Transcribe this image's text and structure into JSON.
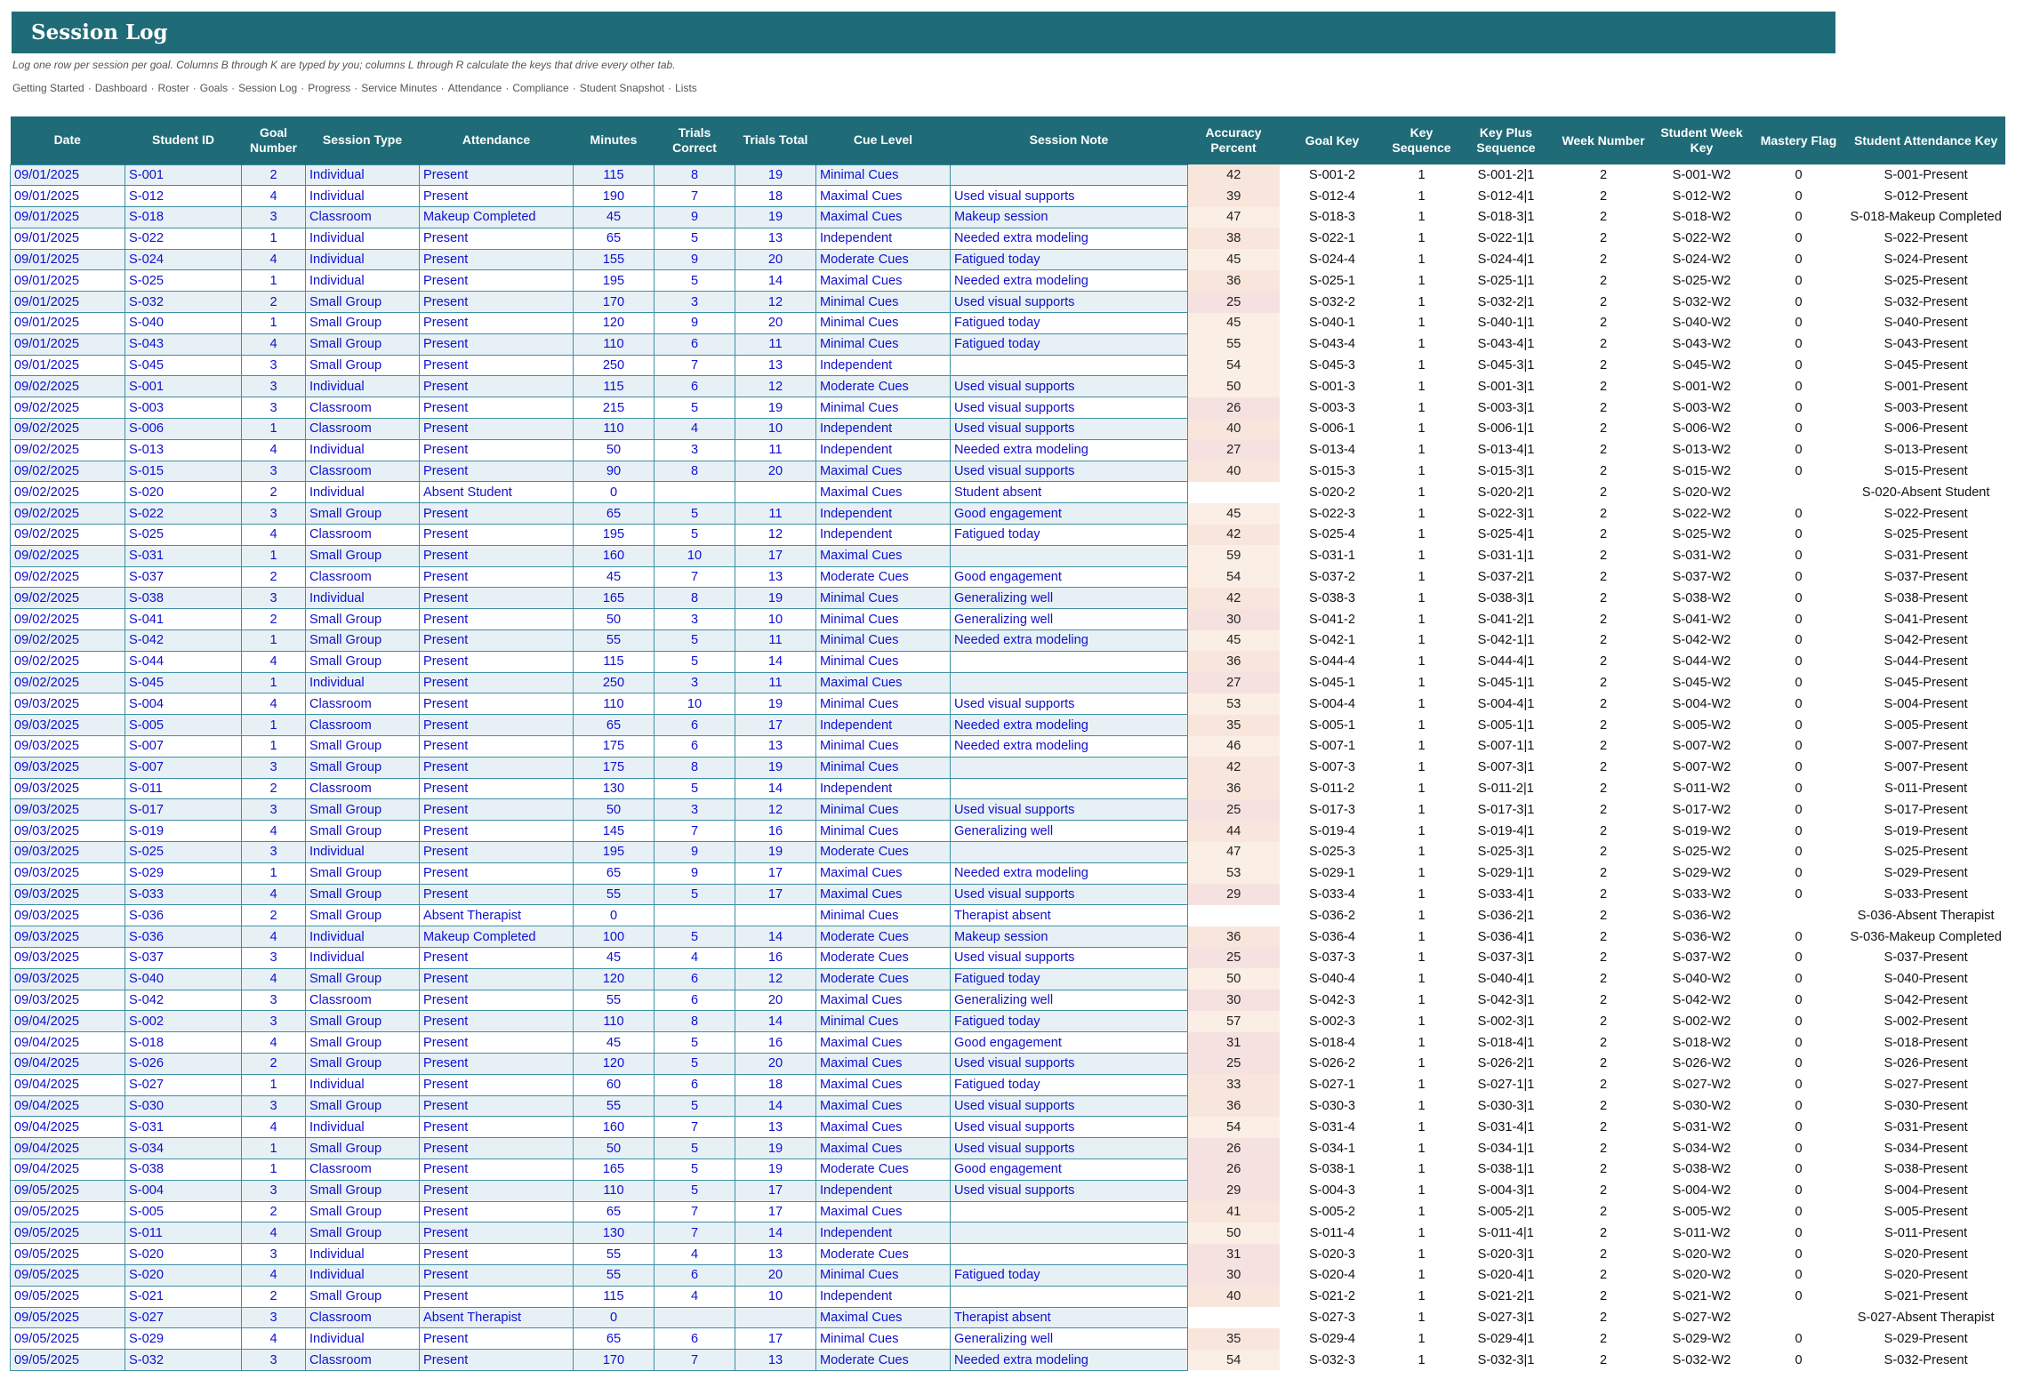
{
  "title": "Session Log",
  "subtitle": "Log one row per session per goal. Columns B through K are typed by you; columns L through R calculate the keys that drive every other tab.",
  "nav": [
    "Getting Started",
    "Dashboard",
    "Roster",
    "Goals",
    "Session Log",
    "Progress",
    "Service Minutes",
    "Attendance",
    "Compliance",
    "Student Snapshot",
    "Lists"
  ],
  "nav_separator": "·",
  "headers": [
    "Date",
    "Student ID",
    "Goal Number",
    "Session Type",
    "Attendance",
    "Minutes",
    "Trials Correct",
    "Trials Total",
    "Cue Level",
    "Session Note",
    "Accuracy Percent",
    "Goal Key",
    "Key Sequence",
    "Key Plus Sequence",
    "Week Number",
    "Student Week Key",
    "Mastery Flag",
    "Student Attendance Key"
  ],
  "rows": [
    [
      "09/01/2025",
      "S-001",
      "2",
      "Individual",
      "Present",
      "115",
      "8",
      "19",
      "Minimal Cues",
      "",
      "42",
      "S-001-2",
      "1",
      "S-001-2|1",
      "2",
      "S-001-W2",
      "0",
      "S-001-Present"
    ],
    [
      "09/01/2025",
      "S-012",
      "4",
      "Individual",
      "Present",
      "190",
      "7",
      "18",
      "Maximal Cues",
      "Used visual supports",
      "39",
      "S-012-4",
      "1",
      "S-012-4|1",
      "2",
      "S-012-W2",
      "0",
      "S-012-Present"
    ],
    [
      "09/01/2025",
      "S-018",
      "3",
      "Classroom",
      "Makeup Completed",
      "45",
      "9",
      "19",
      "Maximal Cues",
      "Makeup session",
      "47",
      "S-018-3",
      "1",
      "S-018-3|1",
      "2",
      "S-018-W2",
      "0",
      "S-018-Makeup Completed"
    ],
    [
      "09/01/2025",
      "S-022",
      "1",
      "Individual",
      "Present",
      "65",
      "5",
      "13",
      "Independent",
      "Needed extra modeling",
      "38",
      "S-022-1",
      "1",
      "S-022-1|1",
      "2",
      "S-022-W2",
      "0",
      "S-022-Present"
    ],
    [
      "09/01/2025",
      "S-024",
      "4",
      "Individual",
      "Present",
      "155",
      "9",
      "20",
      "Moderate Cues",
      "Fatigued today",
      "45",
      "S-024-4",
      "1",
      "S-024-4|1",
      "2",
      "S-024-W2",
      "0",
      "S-024-Present"
    ],
    [
      "09/01/2025",
      "S-025",
      "1",
      "Individual",
      "Present",
      "195",
      "5",
      "14",
      "Maximal Cues",
      "Needed extra modeling",
      "36",
      "S-025-1",
      "1",
      "S-025-1|1",
      "2",
      "S-025-W2",
      "0",
      "S-025-Present"
    ],
    [
      "09/01/2025",
      "S-032",
      "2",
      "Small Group",
      "Present",
      "170",
      "3",
      "12",
      "Minimal Cues",
      "Used visual supports",
      "25",
      "S-032-2",
      "1",
      "S-032-2|1",
      "2",
      "S-032-W2",
      "0",
      "S-032-Present"
    ],
    [
      "09/01/2025",
      "S-040",
      "1",
      "Small Group",
      "Present",
      "120",
      "9",
      "20",
      "Minimal Cues",
      "Fatigued today",
      "45",
      "S-040-1",
      "1",
      "S-040-1|1",
      "2",
      "S-040-W2",
      "0",
      "S-040-Present"
    ],
    [
      "09/01/2025",
      "S-043",
      "4",
      "Small Group",
      "Present",
      "110",
      "6",
      "11",
      "Minimal Cues",
      "Fatigued today",
      "55",
      "S-043-4",
      "1",
      "S-043-4|1",
      "2",
      "S-043-W2",
      "0",
      "S-043-Present"
    ],
    [
      "09/01/2025",
      "S-045",
      "3",
      "Small Group",
      "Present",
      "250",
      "7",
      "13",
      "Independent",
      "",
      "54",
      "S-045-3",
      "1",
      "S-045-3|1",
      "2",
      "S-045-W2",
      "0",
      "S-045-Present"
    ],
    [
      "09/02/2025",
      "S-001",
      "3",
      "Individual",
      "Present",
      "115",
      "6",
      "12",
      "Moderate Cues",
      "Used visual supports",
      "50",
      "S-001-3",
      "1",
      "S-001-3|1",
      "2",
      "S-001-W2",
      "0",
      "S-001-Present"
    ],
    [
      "09/02/2025",
      "S-003",
      "3",
      "Classroom",
      "Present",
      "215",
      "5",
      "19",
      "Minimal Cues",
      "Used visual supports",
      "26",
      "S-003-3",
      "1",
      "S-003-3|1",
      "2",
      "S-003-W2",
      "0",
      "S-003-Present"
    ],
    [
      "09/02/2025",
      "S-006",
      "1",
      "Classroom",
      "Present",
      "110",
      "4",
      "10",
      "Independent",
      "Used visual supports",
      "40",
      "S-006-1",
      "1",
      "S-006-1|1",
      "2",
      "S-006-W2",
      "0",
      "S-006-Present"
    ],
    [
      "09/02/2025",
      "S-013",
      "4",
      "Individual",
      "Present",
      "50",
      "3",
      "11",
      "Independent",
      "Needed extra modeling",
      "27",
      "S-013-4",
      "1",
      "S-013-4|1",
      "2",
      "S-013-W2",
      "0",
      "S-013-Present"
    ],
    [
      "09/02/2025",
      "S-015",
      "3",
      "Classroom",
      "Present",
      "90",
      "8",
      "20",
      "Maximal Cues",
      "Used visual supports",
      "40",
      "S-015-3",
      "1",
      "S-015-3|1",
      "2",
      "S-015-W2",
      "0",
      "S-015-Present"
    ],
    [
      "09/02/2025",
      "S-020",
      "2",
      "Individual",
      "Absent Student",
      "0",
      "",
      "",
      "Maximal Cues",
      "Student absent",
      "",
      "S-020-2",
      "1",
      "S-020-2|1",
      "2",
      "S-020-W2",
      "",
      "S-020-Absent Student"
    ],
    [
      "09/02/2025",
      "S-022",
      "3",
      "Small Group",
      "Present",
      "65",
      "5",
      "11",
      "Independent",
      "Good engagement",
      "45",
      "S-022-3",
      "1",
      "S-022-3|1",
      "2",
      "S-022-W2",
      "0",
      "S-022-Present"
    ],
    [
      "09/02/2025",
      "S-025",
      "4",
      "Classroom",
      "Present",
      "195",
      "5",
      "12",
      "Independent",
      "Fatigued today",
      "42",
      "S-025-4",
      "1",
      "S-025-4|1",
      "2",
      "S-025-W2",
      "0",
      "S-025-Present"
    ],
    [
      "09/02/2025",
      "S-031",
      "1",
      "Small Group",
      "Present",
      "160",
      "10",
      "17",
      "Maximal Cues",
      "",
      "59",
      "S-031-1",
      "1",
      "S-031-1|1",
      "2",
      "S-031-W2",
      "0",
      "S-031-Present"
    ],
    [
      "09/02/2025",
      "S-037",
      "2",
      "Classroom",
      "Present",
      "45",
      "7",
      "13",
      "Moderate Cues",
      "Good engagement",
      "54",
      "S-037-2",
      "1",
      "S-037-2|1",
      "2",
      "S-037-W2",
      "0",
      "S-037-Present"
    ],
    [
      "09/02/2025",
      "S-038",
      "3",
      "Individual",
      "Present",
      "165",
      "8",
      "19",
      "Minimal Cues",
      "Generalizing well",
      "42",
      "S-038-3",
      "1",
      "S-038-3|1",
      "2",
      "S-038-W2",
      "0",
      "S-038-Present"
    ],
    [
      "09/02/2025",
      "S-041",
      "2",
      "Small Group",
      "Present",
      "50",
      "3",
      "10",
      "Minimal Cues",
      "Generalizing well",
      "30",
      "S-041-2",
      "1",
      "S-041-2|1",
      "2",
      "S-041-W2",
      "0",
      "S-041-Present"
    ],
    [
      "09/02/2025",
      "S-042",
      "1",
      "Small Group",
      "Present",
      "55",
      "5",
      "11",
      "Minimal Cues",
      "Needed extra modeling",
      "45",
      "S-042-1",
      "1",
      "S-042-1|1",
      "2",
      "S-042-W2",
      "0",
      "S-042-Present"
    ],
    [
      "09/02/2025",
      "S-044",
      "4",
      "Small Group",
      "Present",
      "115",
      "5",
      "14",
      "Minimal Cues",
      "",
      "36",
      "S-044-4",
      "1",
      "S-044-4|1",
      "2",
      "S-044-W2",
      "0",
      "S-044-Present"
    ],
    [
      "09/02/2025",
      "S-045",
      "1",
      "Individual",
      "Present",
      "250",
      "3",
      "11",
      "Maximal Cues",
      "",
      "27",
      "S-045-1",
      "1",
      "S-045-1|1",
      "2",
      "S-045-W2",
      "0",
      "S-045-Present"
    ],
    [
      "09/03/2025",
      "S-004",
      "4",
      "Classroom",
      "Present",
      "110",
      "10",
      "19",
      "Minimal Cues",
      "Used visual supports",
      "53",
      "S-004-4",
      "1",
      "S-004-4|1",
      "2",
      "S-004-W2",
      "0",
      "S-004-Present"
    ],
    [
      "09/03/2025",
      "S-005",
      "1",
      "Classroom",
      "Present",
      "65",
      "6",
      "17",
      "Independent",
      "Needed extra modeling",
      "35",
      "S-005-1",
      "1",
      "S-005-1|1",
      "2",
      "S-005-W2",
      "0",
      "S-005-Present"
    ],
    [
      "09/03/2025",
      "S-007",
      "1",
      "Small Group",
      "Present",
      "175",
      "6",
      "13",
      "Minimal Cues",
      "Needed extra modeling",
      "46",
      "S-007-1",
      "1",
      "S-007-1|1",
      "2",
      "S-007-W2",
      "0",
      "S-007-Present"
    ],
    [
      "09/03/2025",
      "S-007",
      "3",
      "Small Group",
      "Present",
      "175",
      "8",
      "19",
      "Minimal Cues",
      "",
      "42",
      "S-007-3",
      "1",
      "S-007-3|1",
      "2",
      "S-007-W2",
      "0",
      "S-007-Present"
    ],
    [
      "09/03/2025",
      "S-011",
      "2",
      "Classroom",
      "Present",
      "130",
      "5",
      "14",
      "Independent",
      "",
      "36",
      "S-011-2",
      "1",
      "S-011-2|1",
      "2",
      "S-011-W2",
      "0",
      "S-011-Present"
    ],
    [
      "09/03/2025",
      "S-017",
      "3",
      "Small Group",
      "Present",
      "50",
      "3",
      "12",
      "Minimal Cues",
      "Used visual supports",
      "25",
      "S-017-3",
      "1",
      "S-017-3|1",
      "2",
      "S-017-W2",
      "0",
      "S-017-Present"
    ],
    [
      "09/03/2025",
      "S-019",
      "4",
      "Small Group",
      "Present",
      "145",
      "7",
      "16",
      "Minimal Cues",
      "Generalizing well",
      "44",
      "S-019-4",
      "1",
      "S-019-4|1",
      "2",
      "S-019-W2",
      "0",
      "S-019-Present"
    ],
    [
      "09/03/2025",
      "S-025",
      "3",
      "Individual",
      "Present",
      "195",
      "9",
      "19",
      "Moderate Cues",
      "",
      "47",
      "S-025-3",
      "1",
      "S-025-3|1",
      "2",
      "S-025-W2",
      "0",
      "S-025-Present"
    ],
    [
      "09/03/2025",
      "S-029",
      "1",
      "Small Group",
      "Present",
      "65",
      "9",
      "17",
      "Maximal Cues",
      "Needed extra modeling",
      "53",
      "S-029-1",
      "1",
      "S-029-1|1",
      "2",
      "S-029-W2",
      "0",
      "S-029-Present"
    ],
    [
      "09/03/2025",
      "S-033",
      "4",
      "Small Group",
      "Present",
      "55",
      "5",
      "17",
      "Maximal Cues",
      "Used visual supports",
      "29",
      "S-033-4",
      "1",
      "S-033-4|1",
      "2",
      "S-033-W2",
      "0",
      "S-033-Present"
    ],
    [
      "09/03/2025",
      "S-036",
      "2",
      "Small Group",
      "Absent Therapist",
      "0",
      "",
      "",
      "Minimal Cues",
      "Therapist absent",
      "",
      "S-036-2",
      "1",
      "S-036-2|1",
      "2",
      "S-036-W2",
      "",
      "S-036-Absent Therapist"
    ],
    [
      "09/03/2025",
      "S-036",
      "4",
      "Individual",
      "Makeup Completed",
      "100",
      "5",
      "14",
      "Moderate Cues",
      "Makeup session",
      "36",
      "S-036-4",
      "1",
      "S-036-4|1",
      "2",
      "S-036-W2",
      "0",
      "S-036-Makeup Completed"
    ],
    [
      "09/03/2025",
      "S-037",
      "3",
      "Individual",
      "Present",
      "45",
      "4",
      "16",
      "Moderate Cues",
      "Used visual supports",
      "25",
      "S-037-3",
      "1",
      "S-037-3|1",
      "2",
      "S-037-W2",
      "0",
      "S-037-Present"
    ],
    [
      "09/03/2025",
      "S-040",
      "4",
      "Small Group",
      "Present",
      "120",
      "6",
      "12",
      "Moderate Cues",
      "Fatigued today",
      "50",
      "S-040-4",
      "1",
      "S-040-4|1",
      "2",
      "S-040-W2",
      "0",
      "S-040-Present"
    ],
    [
      "09/03/2025",
      "S-042",
      "3",
      "Classroom",
      "Present",
      "55",
      "6",
      "20",
      "Maximal Cues",
      "Generalizing well",
      "30",
      "S-042-3",
      "1",
      "S-042-3|1",
      "2",
      "S-042-W2",
      "0",
      "S-042-Present"
    ],
    [
      "09/04/2025",
      "S-002",
      "3",
      "Small Group",
      "Present",
      "110",
      "8",
      "14",
      "Minimal Cues",
      "Fatigued today",
      "57",
      "S-002-3",
      "1",
      "S-002-3|1",
      "2",
      "S-002-W2",
      "0",
      "S-002-Present"
    ],
    [
      "09/04/2025",
      "S-018",
      "4",
      "Small Group",
      "Present",
      "45",
      "5",
      "16",
      "Maximal Cues",
      "Good engagement",
      "31",
      "S-018-4",
      "1",
      "S-018-4|1",
      "2",
      "S-018-W2",
      "0",
      "S-018-Present"
    ],
    [
      "09/04/2025",
      "S-026",
      "2",
      "Small Group",
      "Present",
      "120",
      "5",
      "20",
      "Maximal Cues",
      "Used visual supports",
      "25",
      "S-026-2",
      "1",
      "S-026-2|1",
      "2",
      "S-026-W2",
      "0",
      "S-026-Present"
    ],
    [
      "09/04/2025",
      "S-027",
      "1",
      "Individual",
      "Present",
      "60",
      "6",
      "18",
      "Maximal Cues",
      "Fatigued today",
      "33",
      "S-027-1",
      "1",
      "S-027-1|1",
      "2",
      "S-027-W2",
      "0",
      "S-027-Present"
    ],
    [
      "09/04/2025",
      "S-030",
      "3",
      "Small Group",
      "Present",
      "55",
      "5",
      "14",
      "Maximal Cues",
      "Used visual supports",
      "36",
      "S-030-3",
      "1",
      "S-030-3|1",
      "2",
      "S-030-W2",
      "0",
      "S-030-Present"
    ],
    [
      "09/04/2025",
      "S-031",
      "4",
      "Individual",
      "Present",
      "160",
      "7",
      "13",
      "Maximal Cues",
      "Used visual supports",
      "54",
      "S-031-4",
      "1",
      "S-031-4|1",
      "2",
      "S-031-W2",
      "0",
      "S-031-Present"
    ],
    [
      "09/04/2025",
      "S-034",
      "1",
      "Small Group",
      "Present",
      "50",
      "5",
      "19",
      "Maximal Cues",
      "Used visual supports",
      "26",
      "S-034-1",
      "1",
      "S-034-1|1",
      "2",
      "S-034-W2",
      "0",
      "S-034-Present"
    ],
    [
      "09/04/2025",
      "S-038",
      "1",
      "Classroom",
      "Present",
      "165",
      "5",
      "19",
      "Moderate Cues",
      "Good engagement",
      "26",
      "S-038-1",
      "1",
      "S-038-1|1",
      "2",
      "S-038-W2",
      "0",
      "S-038-Present"
    ],
    [
      "09/05/2025",
      "S-004",
      "3",
      "Small Group",
      "Present",
      "110",
      "5",
      "17",
      "Independent",
      "Used visual supports",
      "29",
      "S-004-3",
      "1",
      "S-004-3|1",
      "2",
      "S-004-W2",
      "0",
      "S-004-Present"
    ],
    [
      "09/05/2025",
      "S-005",
      "2",
      "Small Group",
      "Present",
      "65",
      "7",
      "17",
      "Maximal Cues",
      "",
      "41",
      "S-005-2",
      "1",
      "S-005-2|1",
      "2",
      "S-005-W2",
      "0",
      "S-005-Present"
    ],
    [
      "09/05/2025",
      "S-011",
      "4",
      "Small Group",
      "Present",
      "130",
      "7",
      "14",
      "Independent",
      "",
      "50",
      "S-011-4",
      "1",
      "S-011-4|1",
      "2",
      "S-011-W2",
      "0",
      "S-011-Present"
    ],
    [
      "09/05/2025",
      "S-020",
      "3",
      "Individual",
      "Present",
      "55",
      "4",
      "13",
      "Moderate Cues",
      "",
      "31",
      "S-020-3",
      "1",
      "S-020-3|1",
      "2",
      "S-020-W2",
      "0",
      "S-020-Present"
    ],
    [
      "09/05/2025",
      "S-020",
      "4",
      "Individual",
      "Present",
      "55",
      "6",
      "20",
      "Minimal Cues",
      "Fatigued today",
      "30",
      "S-020-4",
      "1",
      "S-020-4|1",
      "2",
      "S-020-W2",
      "0",
      "S-020-Present"
    ],
    [
      "09/05/2025",
      "S-021",
      "2",
      "Small Group",
      "Present",
      "115",
      "4",
      "10",
      "Independent",
      "",
      "40",
      "S-021-2",
      "1",
      "S-021-2|1",
      "2",
      "S-021-W2",
      "0",
      "S-021-Present"
    ],
    [
      "09/05/2025",
      "S-027",
      "3",
      "Classroom",
      "Absent Therapist",
      "0",
      "",
      "",
      "Maximal Cues",
      "Therapist absent",
      "",
      "S-027-3",
      "1",
      "S-027-3|1",
      "2",
      "S-027-W2",
      "",
      "S-027-Absent Therapist"
    ],
    [
      "09/05/2025",
      "S-029",
      "4",
      "Individual",
      "Present",
      "65",
      "6",
      "17",
      "Minimal Cues",
      "Generalizing well",
      "35",
      "S-029-4",
      "1",
      "S-029-4|1",
      "2",
      "S-029-W2",
      "0",
      "S-029-Present"
    ],
    [
      "09/05/2025",
      "S-032",
      "3",
      "Classroom",
      "Present",
      "170",
      "7",
      "13",
      "Moderate Cues",
      "Needed extra modeling",
      "54",
      "S-032-3",
      "1",
      "S-032-3|1",
      "2",
      "S-032-W2",
      "0",
      "S-032-Present"
    ]
  ]
}
